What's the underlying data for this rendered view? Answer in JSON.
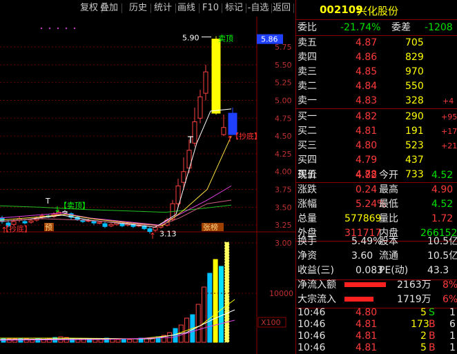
{
  "toolbar": {
    "buttons": [
      "复权",
      "叠加",
      "历史",
      "统计",
      "画线",
      "F10",
      "标记",
      "-自选",
      "返回"
    ]
  },
  "chart": {
    "price_labels": [
      "5.75",
      "5.50",
      "5.25",
      "5.00",
      "4.75",
      "4.50",
      "4.25",
      "4.00",
      "3.75",
      "3.50",
      "3.25",
      "3.00"
    ],
    "current_price_tag": "5.86",
    "high_label": "5.90",
    "low_label": "3.13",
    "sell_top_tag": "【卖顶】",
    "buy_bottom_tag_right": "【抄底】",
    "buy_bottom_tag_left": "【抄底】",
    "marker_t": "T",
    "sell_top_tag_top": "卖顶",
    "volume_label": "10000",
    "volume_unit": "X100",
    "bottom_tags": [
      "预",
      "张榜"
    ]
  },
  "quote": {
    "code": "002109",
    "name": "兴化股份",
    "weibi_label": "委比",
    "weibi_value": "-21.74%",
    "weicha_label": "委差",
    "weicha_value": "-1208",
    "asks": [
      {
        "label": "卖五",
        "price": "4.87",
        "vol": "705",
        "chg": ""
      },
      {
        "label": "卖四",
        "price": "4.86",
        "vol": "829",
        "chg": ""
      },
      {
        "label": "卖三",
        "price": "4.85",
        "vol": "970",
        "chg": ""
      },
      {
        "label": "卖二",
        "price": "4.84",
        "vol": "550",
        "chg": ""
      },
      {
        "label": "卖一",
        "price": "4.83",
        "vol": "328",
        "chg": "+4"
      }
    ],
    "bids": [
      {
        "label": "买一",
        "price": "4.82",
        "vol": "290",
        "chg": "+95"
      },
      {
        "label": "买二",
        "price": "4.81",
        "vol": "191",
        "chg": "+17"
      },
      {
        "label": "买三",
        "price": "4.80",
        "vol": "523",
        "chg": "+21"
      },
      {
        "label": "买四",
        "price": "4.79",
        "vol": "437",
        "chg": ""
      },
      {
        "label": "买五",
        "price": "4.78",
        "vol": "733",
        "chg": ""
      }
    ],
    "stats": [
      {
        "l1": "现价",
        "v1": "4.82",
        "l2": "今开",
        "v2": "4.52",
        "c1": "red",
        "c2": "green"
      },
      {
        "l1": "涨跌",
        "v1": "0.24",
        "l2": "最高",
        "v2": "4.90",
        "c1": "red",
        "c2": "red"
      },
      {
        "l1": "涨幅",
        "v1": "5.24%",
        "l2": "最低",
        "v2": "4.52",
        "c1": "red",
        "c2": "green"
      },
      {
        "l1": "总量",
        "v1": "577869",
        "l2": "量比",
        "v2": "1.72",
        "c1": "yellow",
        "c2": "red"
      },
      {
        "l1": "外盘",
        "v1": "311717",
        "l2": "内盘",
        "v2": "266152",
        "c1": "red",
        "c2": "green"
      }
    ],
    "stats2": [
      {
        "l1": "换手",
        "v1": "5.49%",
        "l2": "股本",
        "v2": "10.5亿"
      },
      {
        "l1": "净资",
        "v1": "3.60",
        "l2": "流通",
        "v2": "10.5亿"
      },
      {
        "l1": "收益(三)",
        "v1": "0.083",
        "l2": "PE(动)",
        "v2": "43.3"
      }
    ],
    "flows": [
      {
        "label": "净流入额",
        "value": "2163万",
        "pct": "8%",
        "fill": 0.85
      },
      {
        "label": "大宗流入",
        "value": "1719万",
        "pct": "6%",
        "fill": 0.6
      }
    ],
    "ticks": [
      {
        "time": "10:46",
        "price": "4.80",
        "vol": "5",
        "side": "S",
        "n": "1"
      },
      {
        "time": "10:46",
        "price": "4.81",
        "vol": "173",
        "side": "B",
        "n": "6"
      },
      {
        "time": "10:46",
        "price": "4.81",
        "vol": "2",
        "side": "B",
        "n": "1"
      },
      {
        "time": "10:46",
        "price": "4.81",
        "vol": "5",
        "side": "B",
        "n": "1"
      }
    ]
  }
}
